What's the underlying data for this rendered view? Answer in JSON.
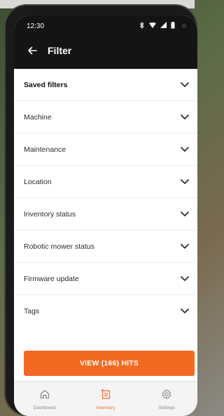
{
  "status_bar": {
    "time": "12:30"
  },
  "header": {
    "title": "Filter"
  },
  "filters": [
    {
      "label": "Saved filters",
      "emphasis": true
    },
    {
      "label": "Machine"
    },
    {
      "label": "Maintenance"
    },
    {
      "label": "Location"
    },
    {
      "label": "Inventory status"
    },
    {
      "label": "Robotic mower status"
    },
    {
      "label": "Firmware update"
    },
    {
      "label": "Tags"
    }
  ],
  "cta": {
    "label": "VIEW (166) HITS"
  },
  "bottom_nav": [
    {
      "label": "Dashboard",
      "icon": "home-icon",
      "active": false
    },
    {
      "label": "Inventory",
      "icon": "inventory-icon",
      "active": true
    },
    {
      "label": "Settings",
      "icon": "gear-icon",
      "active": false
    }
  ],
  "colors": {
    "accent": "#f26a21",
    "app_bar": "#141414"
  }
}
